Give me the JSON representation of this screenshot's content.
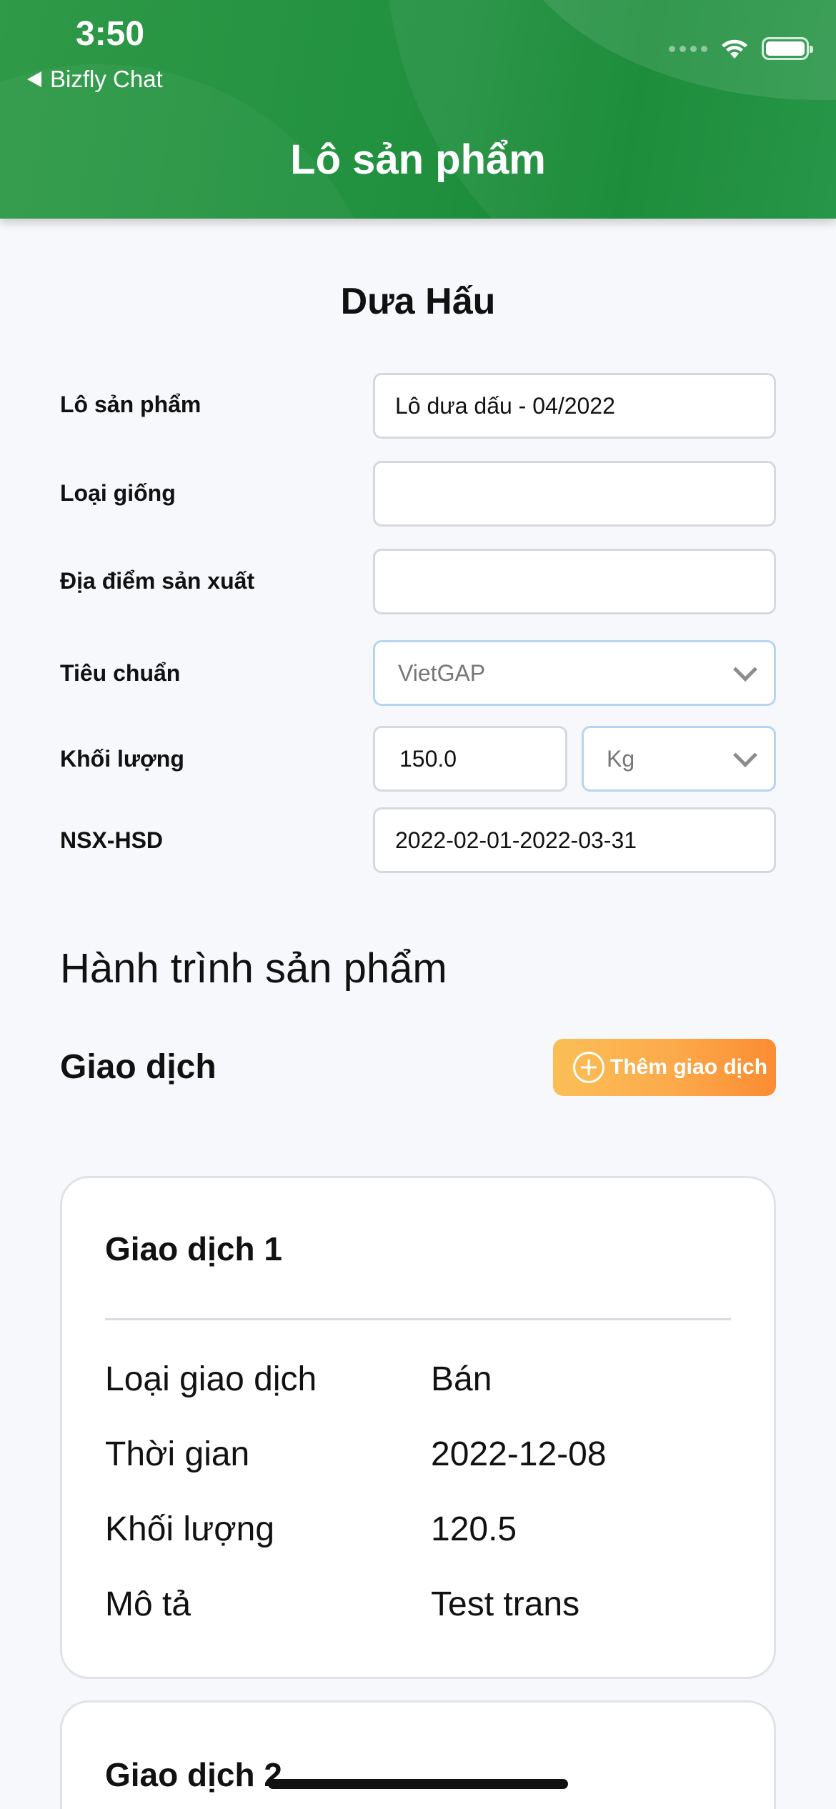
{
  "status_bar": {
    "time": "3:50",
    "back_app": "Bizfly Chat"
  },
  "header": {
    "title": "Lô sản phẩm"
  },
  "product": {
    "name": "Dưa Hấu"
  },
  "form": {
    "lot_label": "Lô sản phẩm",
    "lot_value": "Lô dưa dấu - 04/2022",
    "variety_label": "Loại giống",
    "variety_value": "",
    "location_label": "Địa điểm sản xuất",
    "location_value": "",
    "standard_label": "Tiêu chuẩn",
    "standard_value": "VietGAP",
    "weight_label": "Khối lượng",
    "weight_value": "150.0",
    "unit_value": "Kg",
    "dates_label": "NSX-HSD",
    "dates_value": "2022-02-01-2022-03-31"
  },
  "journey": {
    "title": "Hành trình sản phẩm",
    "transactions_heading": "Giao dịch",
    "add_button_label": "Thêm giao dịch",
    "transactions": [
      {
        "title": "Giao dịch 1",
        "type_label": "Loại giao dịch",
        "type_value": "Bán",
        "time_label": "Thời gian",
        "time_value": "2022-12-08",
        "weight_label": "Khối lượng",
        "weight_value": "120.5",
        "desc_label": "Mô tả",
        "desc_value": "Test trans"
      },
      {
        "title": "Giao dịch 2"
      }
    ]
  }
}
